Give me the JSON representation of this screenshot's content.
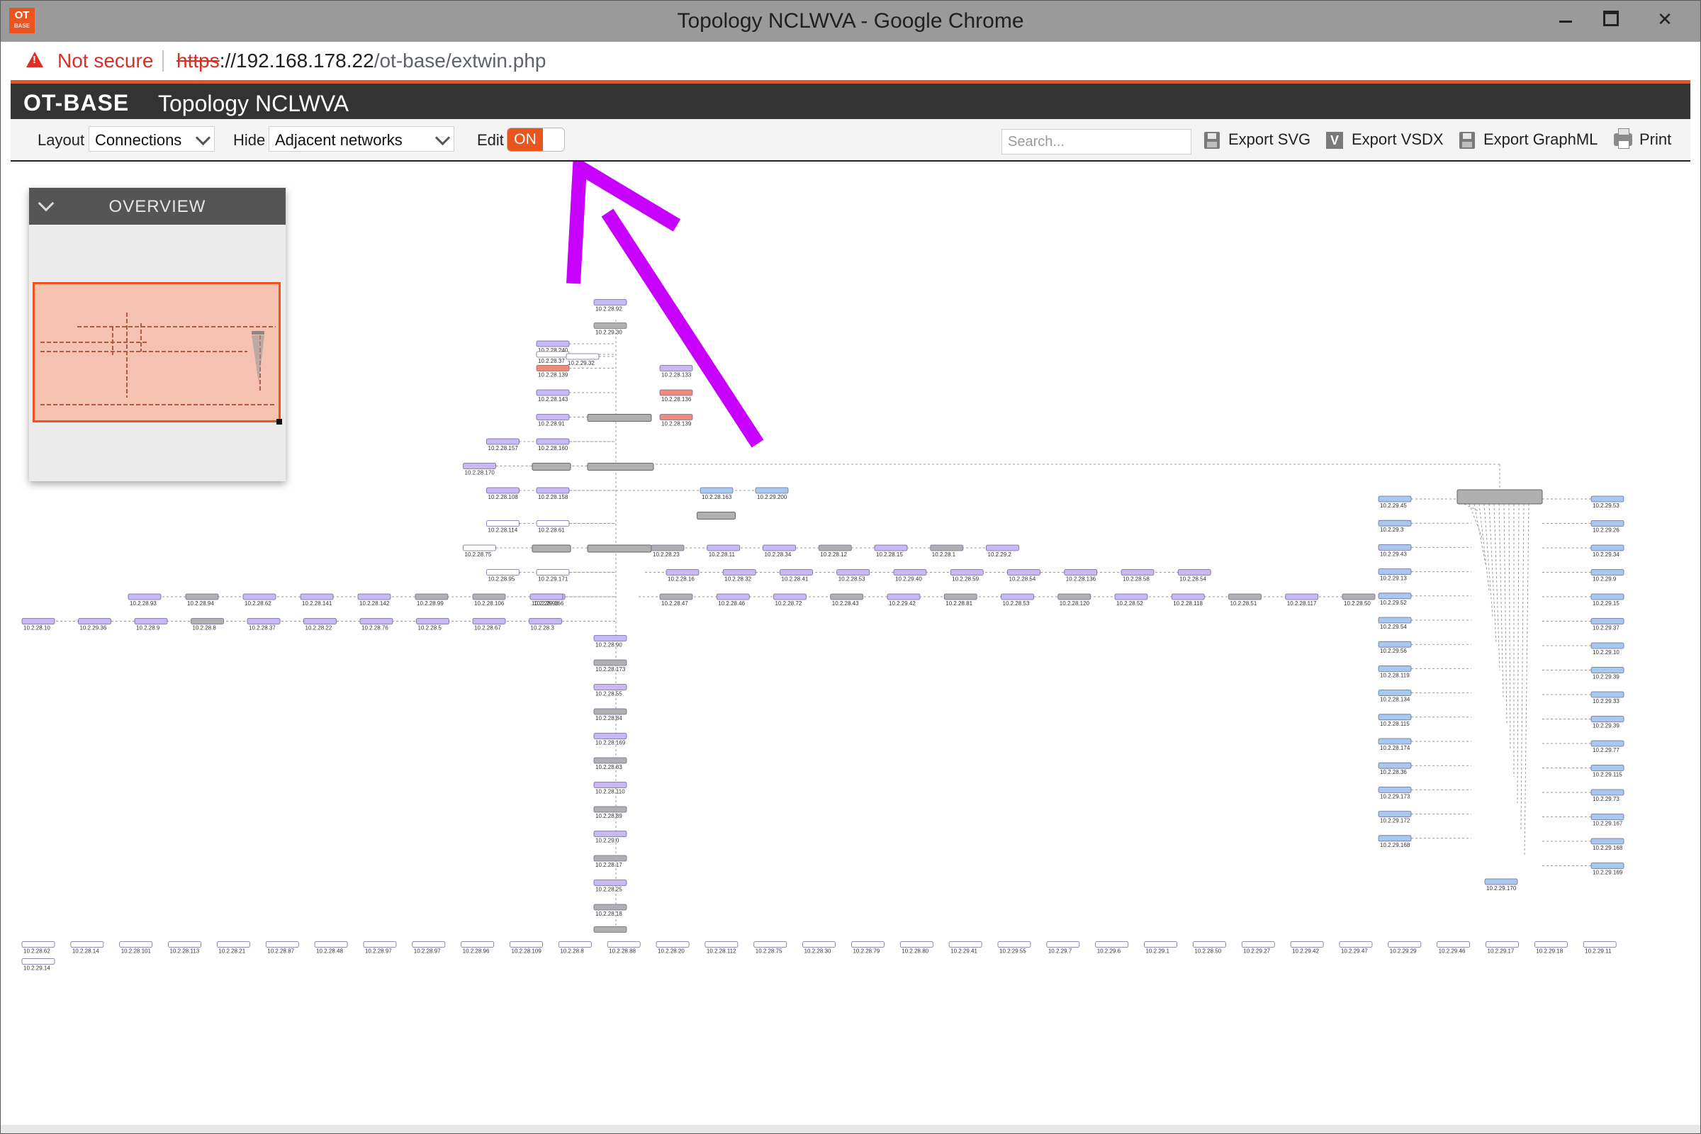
{
  "window": {
    "title": "Topology NCLWVA - Google Chrome",
    "app_icon_top": "OT",
    "app_icon_bottom": "BASE",
    "controls": {
      "minimize_icon": "minimize-icon",
      "maximize_icon": "maximize-icon",
      "close_label": "✕"
    }
  },
  "address_bar": {
    "security_label": "Not secure",
    "url_scheme": "https",
    "url_host": "://192.168.178.22",
    "url_path": "/ot-base/extwin.php"
  },
  "header": {
    "brand": "OT-BASE",
    "title": "Topology NCLWVA"
  },
  "toolbar": {
    "layout_label": "Layout",
    "layout_value": "Connections",
    "hide_label": "Hide",
    "hide_value": "Adjacent networks",
    "edit_label": "Edit",
    "edit_toggle": "ON",
    "search_placeholder": "Search...",
    "export_svg": "Export SVG",
    "export_vsdx": "Export VSDX",
    "vsdx_icon_letter": "V",
    "export_graphml": "Export GraphML",
    "print": "Print"
  },
  "overview": {
    "title": "OVERVIEW"
  },
  "colors": {
    "accent": "#e9541f",
    "arrow": "#c800ff",
    "node_purple": "#c9b8f2",
    "node_gray": "#b0b0b0",
    "node_blue": "#a8c8ee",
    "node_red": "#f08a7a",
    "header_bg": "#333333"
  },
  "topology": {
    "top_nodes": [
      {
        "ip": "10.2.28.92",
        "kind": "purple"
      },
      {
        "ip": "10.2.29.30",
        "kind": "gray"
      }
    ],
    "switch_cluster_ips": [
      "10.2.28.240",
      "10.2.28.37",
      "10.2.29.32",
      "10.2.28.139",
      "10.2.28.143",
      "10.2.28.91",
      "10.2.28.160",
      "10.2.28.157",
      "10.2.28.170",
      "10.2.28.108",
      "10.2.28.158",
      "10.2.28.114",
      "10.2.28.61",
      "10.2.28.75",
      "10.2.28.95",
      "10.2.29.171",
      "10.2.29.166",
      "10.2.28.163",
      "10.2.29.200"
    ],
    "right_branch_row1": [
      "10.2.28.23",
      "10.2.28.11",
      "10.2.28.34",
      "10.2.28.12",
      "10.2.28.15",
      "10.2.28.1",
      "10.2.29.2"
    ],
    "right_branch_row2": [
      "10.2.28.16",
      "10.2.28.32",
      "10.2.28.41",
      "10.2.28.53",
      "10.2.29.40",
      "10.2.28.59",
      "10.2.28.54",
      "10.2.28.136",
      "10.2.28.58",
      "10.2.28.54"
    ],
    "right_branch_row3": [
      "10.2.28.47",
      "10.2.28.46",
      "10.2.28.72",
      "10.2.28.43",
      "10.2.29.42",
      "10.2.28.81",
      "10.2.28.53",
      "10.2.28.120",
      "10.2.28.52",
      "10.2.28.118",
      "10.2.28.51",
      "10.2.28.117",
      "10.2.28.50"
    ],
    "left_row1": [
      "10.2.28.93",
      "10.2.28.94",
      "10.2.28.62",
      "10.2.28.141",
      "10.2.28.142",
      "10.2.28.99",
      "10.2.28.106",
      "10.2.28.98"
    ],
    "left_row2": [
      "10.2.28.10",
      "10.2.29.36",
      "10.2.28.9",
      "10.2.28.8",
      "10.2.28.37",
      "10.2.28.22",
      "10.2.28.76",
      "10.2.28.5",
      "10.2.28.67",
      "10.2.28.3"
    ],
    "vertical_chain": [
      "10.2.28.90",
      "10.2.28.173",
      "10.2.28.55",
      "10.2.28.84",
      "10.2.28.169",
      "10.2.28.83",
      "10.2.28.110",
      "10.2.28.89",
      "10.2.29.0",
      "10.2.28.17",
      "10.2.28.25",
      "10.2.28.18"
    ],
    "bottom_row": [
      "10.2.28.62",
      "10.2.28.14",
      "10.2.28.101",
      "10.2.28.113",
      "10.2.28.21",
      "10.2.28.87",
      "10.2.28.48",
      "10.2.28.97",
      "10.2.28.97",
      "10.2.28.96",
      "10.2.28.109",
      "10.2.28.8",
      "10.2.28.88",
      "10.2.28.20",
      "10.2.28.112",
      "10.2.28.75",
      "10.2.28.30",
      "10.2.28.79",
      "10.2.28.80",
      "10.2.29.41",
      "10.2.29.55",
      "10.2.29.7",
      "10.2.29.6",
      "10.2.29.1",
      "10.2.28.50",
      "10.2.29.27",
      "10.2.29.42",
      "10.2.29.47",
      "10.2.29.29",
      "10.2.29.46",
      "10.2.29.17",
      "10.2.29.18",
      "10.2.29.11"
    ],
    "bottom_row_extra": [
      "10.2.29.14"
    ],
    "right_left_col": [
      "10.2.29.45",
      "10.2.29.3",
      "10.2.29.43",
      "10.2.29.13",
      "10.2.29.52",
      "10.2.29.54",
      "10.2.29.56",
      "10.2.28.119",
      "10.2.28.134",
      "10.2.28.115",
      "10.2.28.174",
      "10.2.28.36",
      "10.2.29.173",
      "10.2.29.172",
      "10.2.29.168"
    ],
    "right_right_col": [
      "10.2.29.53",
      "10.2.29.26",
      "10.2.29.34",
      "10.2.29.9",
      "10.2.29.15",
      "10.2.29.37",
      "10.2.29.10",
      "10.2.29.39",
      "10.2.29.33",
      "10.2.29.39",
      "10.2.29.77",
      "10.2.29.115",
      "10.2.29.73",
      "10.2.29.167",
      "10.2.29.168",
      "10.2.29.169"
    ],
    "right_bottom_node": "10.2.29.170"
  }
}
